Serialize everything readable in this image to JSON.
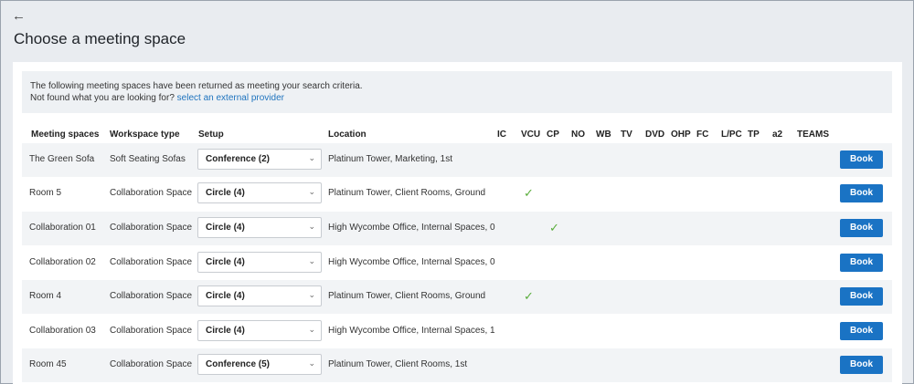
{
  "header": {
    "back_icon": "arrow-left-icon",
    "title": "Choose a meeting space"
  },
  "info": {
    "line1": "The following meeting spaces have been returned as meeting your search criteria.",
    "line2_prefix": "Not found what you are looking for?",
    "line2_link": "select an external provider"
  },
  "columns": {
    "name": "Meeting spaces",
    "type": "Workspace type",
    "setup": "Setup",
    "location": "Location",
    "ic": "IC",
    "vcu": "VCU",
    "cp": "CP",
    "no": "NO",
    "wb": "WB",
    "tv": "TV",
    "dvd": "DVD",
    "ohp": "OHP",
    "fc": "FC",
    "lpc": "L/PC",
    "tp": "TP",
    "a2": "a2",
    "teams": "TEAMS"
  },
  "rows": [
    {
      "name": "The Green Sofa",
      "type": "Soft Seating Sofas",
      "setup": "Conference (2)",
      "location": "Platinum Tower, Marketing, 1st",
      "vcu": false,
      "cp": false,
      "book": "Book"
    },
    {
      "name": "Room 5",
      "type": "Collaboration Space",
      "setup": "Circle (4)",
      "location": "Platinum Tower, Client Rooms, Ground",
      "vcu": true,
      "cp": false,
      "book": "Book"
    },
    {
      "name": "Collaboration 01",
      "type": "Collaboration Space",
      "setup": "Circle (4)",
      "location": "High Wycombe Office, Internal Spaces, 0",
      "vcu": false,
      "cp": true,
      "book": "Book"
    },
    {
      "name": "Collaboration 02",
      "type": "Collaboration Space",
      "setup": "Circle (4)",
      "location": "High Wycombe Office, Internal Spaces, 0",
      "vcu": false,
      "cp": false,
      "book": "Book"
    },
    {
      "name": "Room 4",
      "type": "Collaboration Space",
      "setup": "Circle (4)",
      "location": "Platinum Tower, Client Rooms, Ground",
      "vcu": true,
      "cp": false,
      "book": "Book"
    },
    {
      "name": "Collaboration 03",
      "type": "Collaboration Space",
      "setup": "Circle (4)",
      "location": "High Wycombe Office, Internal Spaces, 1",
      "vcu": false,
      "cp": false,
      "book": "Book"
    },
    {
      "name": "Room 45",
      "type": "Collaboration Space",
      "setup": "Conference (5)",
      "location": "Platinum Tower, Client Rooms, 1st",
      "vcu": false,
      "cp": false,
      "book": "Book"
    }
  ],
  "icons": {
    "check": "check-icon",
    "chevron": "chevron-down-icon"
  },
  "colors": {
    "accent": "#1a73c4",
    "link": "#1e73be",
    "check": "#5aad3c"
  }
}
